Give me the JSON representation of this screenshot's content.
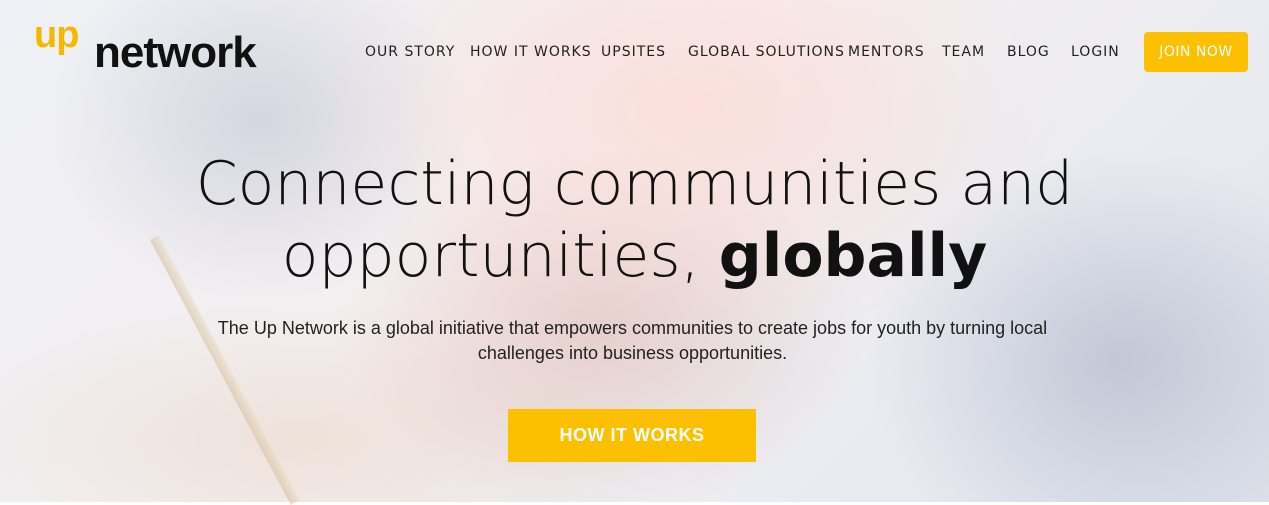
{
  "colors": {
    "accent": "#fcc000",
    "logo_up": "#f5b800",
    "text": "#111111"
  },
  "logo": {
    "up": "up",
    "network": "network"
  },
  "nav": {
    "items": [
      "OUR STORY",
      "HOW IT WORKS",
      "UPSITES",
      "GLOBAL SOLUTIONS",
      "MENTORS",
      "TEAM",
      "BLOG",
      "LOGIN"
    ],
    "join_label": "JOIN NOW"
  },
  "hero": {
    "headline_line1": "Connecting communities and",
    "headline_line2_light": "opportunities, ",
    "headline_line2_bold": "globally",
    "subtitle": "The Up Network is a global initiative that empowers communities to create jobs for youth by turning local challenges into business opportunities.",
    "cta_label": "HOW IT WORKS"
  }
}
